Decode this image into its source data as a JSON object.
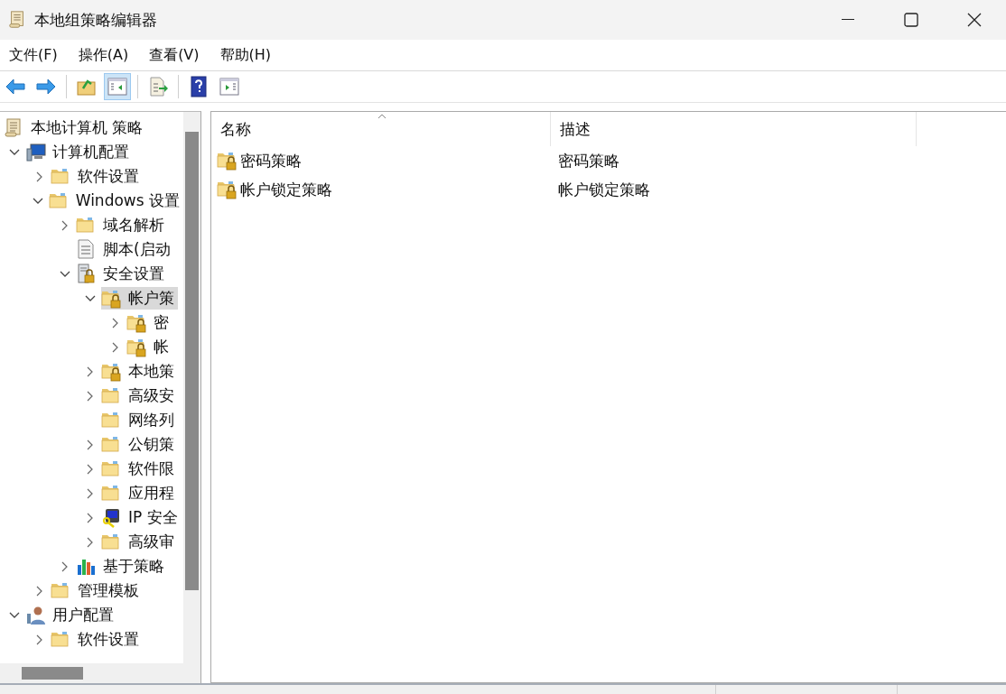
{
  "window": {
    "title": "本地组策略编辑器"
  },
  "menu": [
    "文件(F)",
    "操作(A)",
    "查看(V)",
    "帮助(H)"
  ],
  "toolbar": [
    {
      "kind": "back",
      "pressed": false
    },
    {
      "kind": "forward",
      "pressed": false
    },
    {
      "kind": "sep"
    },
    {
      "kind": "up",
      "pressed": false
    },
    {
      "kind": "tree",
      "pressed": true
    },
    {
      "kind": "sep"
    },
    {
      "kind": "export",
      "pressed": false
    },
    {
      "kind": "sep"
    },
    {
      "kind": "help",
      "pressed": false
    },
    {
      "kind": "pane",
      "pressed": false
    }
  ],
  "tree": [
    {
      "label": "本地计算机 策略",
      "kind": "scroll",
      "selected": false,
      "children": [
        {
          "label": "计算机配置",
          "kind": "computer",
          "has_children": true,
          "expanded": true,
          "selected": false,
          "children": [
            {
              "label": "软件设置",
              "kind": "folder",
              "has_children": true,
              "expanded": false,
              "selected": false
            },
            {
              "label": "Windows 设置",
              "kind": "folder",
              "has_children": true,
              "expanded": true,
              "selected": false,
              "children": [
                {
                  "label": "域名解析",
                  "kind": "folder",
                  "has_children": true,
                  "expanded": false,
                  "selected": false
                },
                {
                  "label": "脚本(启动",
                  "kind": "script",
                  "has_children": false,
                  "selected": false
                },
                {
                  "label": "安全设置",
                  "kind": "server-lock",
                  "has_children": true,
                  "expanded": true,
                  "selected": false,
                  "children": [
                    {
                      "label": "帐户策",
                      "kind": "locked-folder",
                      "has_children": true,
                      "expanded": true,
                      "selected": true,
                      "children": [
                        {
                          "label": "密",
                          "kind": "locked-folder",
                          "has_children": true,
                          "expanded": false,
                          "selected": false
                        },
                        {
                          "label": "帐",
                          "kind": "locked-folder",
                          "has_children": true,
                          "expanded": false,
                          "selected": false
                        }
                      ]
                    },
                    {
                      "label": "本地策",
                      "kind": "locked-folder",
                      "has_children": true,
                      "expanded": false,
                      "selected": false
                    },
                    {
                      "label": "高级安",
                      "kind": "folder",
                      "has_children": true,
                      "expanded": false,
                      "selected": false
                    },
                    {
                      "label": "网络列",
                      "kind": "folder",
                      "has_children": false,
                      "selected": false
                    },
                    {
                      "label": "公钥策",
                      "kind": "folder",
                      "has_children": true,
                      "expanded": false,
                      "selected": false
                    },
                    {
                      "label": "软件限",
                      "kind": "folder",
                      "has_children": true,
                      "expanded": false,
                      "selected": false
                    },
                    {
                      "label": "应用程",
                      "kind": "folder",
                      "has_children": true,
                      "expanded": false,
                      "selected": false
                    },
                    {
                      "label": "IP 安全",
                      "kind": "ip-security",
                      "has_children": true,
                      "expanded": false,
                      "selected": false
                    },
                    {
                      "label": "高级审",
                      "kind": "folder",
                      "has_children": true,
                      "expanded": false,
                      "selected": false
                    }
                  ]
                },
                {
                  "label": "基于策略",
                  "kind": "chart",
                  "has_children": true,
                  "expanded": false,
                  "selected": false
                }
              ]
            },
            {
              "label": "管理模板",
              "kind": "folder",
              "has_children": true,
              "expanded": false,
              "selected": false
            }
          ]
        },
        {
          "label": "用户配置",
          "kind": "user",
          "has_children": true,
          "expanded": true,
          "selected": false,
          "children": [
            {
              "label": "软件设置",
              "kind": "folder",
              "has_children": true,
              "expanded": false,
              "selected": false
            }
          ]
        }
      ]
    }
  ],
  "list": {
    "columns": [
      "名称",
      "描述"
    ],
    "rows": [
      {
        "name": "密码策略",
        "description": "密码策略"
      },
      {
        "name": "帐户锁定策略",
        "description": "帐户锁定策略"
      }
    ]
  }
}
